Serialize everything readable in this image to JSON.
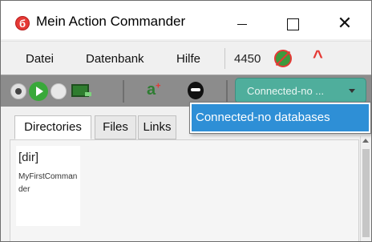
{
  "window": {
    "title": "Mein Action Commander",
    "app_icon": "б",
    "close_glyph": "✕"
  },
  "menu": {
    "items": [
      "Datei",
      "Datenbank",
      "Hilfe"
    ],
    "count": "4450"
  },
  "toolbar": {
    "icons": [
      "record-icon",
      "play-icon",
      "stop-icon",
      "screen-capture-icon",
      "add-user-icon",
      "database-icon"
    ],
    "add_user_glyph": "a",
    "add_user_super": "+",
    "connection_select_value": "Connected-no ..."
  },
  "dropdown": {
    "options": [
      "Connected-no databases"
    ]
  },
  "tabs": [
    {
      "label": "Directories",
      "active": true
    },
    {
      "label": "Files",
      "active": false
    },
    {
      "label": "Links",
      "active": false
    }
  ],
  "directory": {
    "type_label": "[dir]",
    "name": "MyFirstCommander"
  },
  "colors": {
    "accent_red": "#e53935",
    "select_teal": "#4fae9c",
    "highlight_blue": "#2e8fd6"
  }
}
